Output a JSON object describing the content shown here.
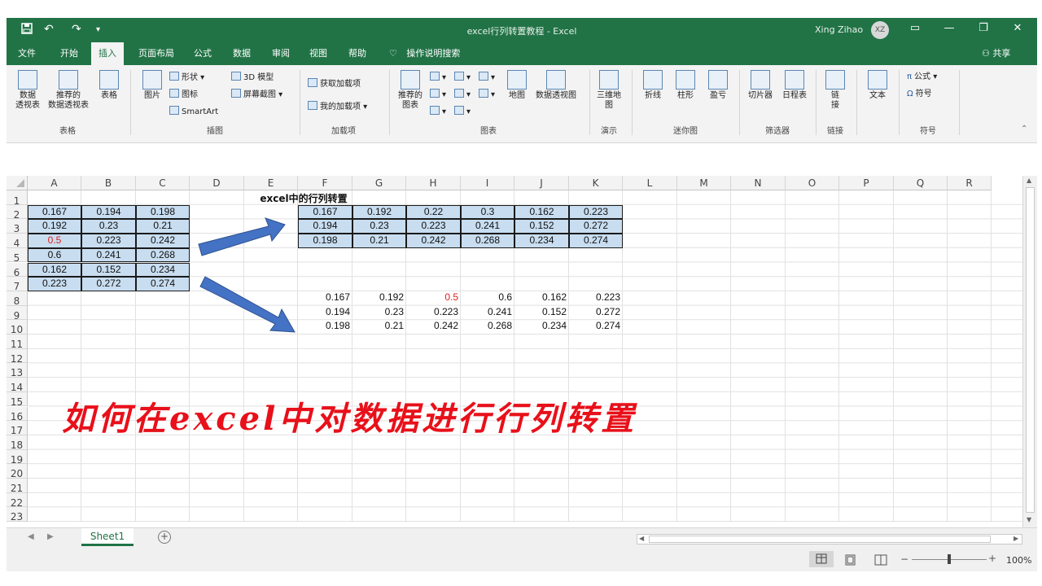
{
  "titlebar": {
    "title": "excel行列转置教程  -  Excel",
    "user": "Xing Zihao",
    "avatar": "XZ",
    "qat": [
      "save-icon",
      "undo-icon",
      "redo-icon",
      "customize-icon"
    ]
  },
  "tabs": [
    "文件",
    "开始",
    "插入",
    "页面布局",
    "公式",
    "数据",
    "审阅",
    "视图",
    "帮助"
  ],
  "active_tab": "插入",
  "tell_me": "操作说明搜索",
  "share": "共享",
  "ribbon": {
    "groups": {
      "tables": "表格",
      "illustrations": "插图",
      "addins": "加载项",
      "charts": "图表",
      "tours": "演示",
      "sparklines": "迷你图",
      "filters": "筛选器",
      "links": "链接",
      "symbols": "符号"
    },
    "buttons": {
      "pivot_line1": "数据",
      "pivot_line2": "透视表",
      "rec_pivot_line1": "推荐的",
      "rec_pivot_line2": "数据透视表",
      "table": "表格",
      "pictures": "图片",
      "shapes": "形状",
      "icons": "图标",
      "smartart": "SmartArt",
      "model3d": "3D 模型",
      "screenshot": "屏幕截图",
      "get_addins": "获取加载项",
      "my_addins": "我的加载项",
      "rec_charts_line1": "推荐的",
      "rec_charts_line2": "图表",
      "map": "地图",
      "pivot_chart": "数据透视图",
      "map3d_line1": "三维地",
      "map3d_line2": "图",
      "spark_line": "折线",
      "spark_column": "柱形",
      "spark_winloss": "盈亏",
      "slicer": "切片器",
      "timeline": "日程表",
      "link_line1": "链",
      "link_line2": "接",
      "text": "文本",
      "equation": "公式",
      "symbol": "符号"
    }
  },
  "grid": {
    "columns": [
      "A",
      "B",
      "C",
      "D",
      "E",
      "F",
      "G",
      "H",
      "I",
      "J",
      "K",
      "L",
      "M",
      "N",
      "O",
      "P",
      "Q",
      "R"
    ],
    "rows": [
      "1",
      "2",
      "3",
      "4",
      "5",
      "6",
      "7",
      "8",
      "9",
      "10",
      "11",
      "12",
      "13",
      "14",
      "15",
      "16",
      "17",
      "18",
      "19",
      "20",
      "21",
      "22",
      "23"
    ],
    "heading": "excel中的行列转置",
    "source": [
      [
        "0.167",
        "0.194",
        "0.198"
      ],
      [
        "0.192",
        "0.23",
        "0.21"
      ],
      [
        "0.5",
        "0.223",
        "0.242"
      ],
      [
        "0.6",
        "0.241",
        "0.268"
      ],
      [
        "0.162",
        "0.152",
        "0.234"
      ],
      [
        "0.223",
        "0.272",
        "0.274"
      ]
    ],
    "transposed_boxed": [
      [
        "0.167",
        "0.192",
        "0.22",
        "0.3",
        "0.162",
        "0.223"
      ],
      [
        "0.194",
        "0.23",
        "0.223",
        "0.241",
        "0.152",
        "0.272"
      ],
      [
        "0.198",
        "0.21",
        "0.242",
        "0.268",
        "0.234",
        "0.274"
      ]
    ],
    "transposed_plain": [
      [
        "0.167",
        "0.192",
        "0.5",
        "0.6",
        "0.162",
        "0.223"
      ],
      [
        "0.194",
        "0.23",
        "0.223",
        "0.241",
        "0.152",
        "0.272"
      ],
      [
        "0.198",
        "0.21",
        "0.242",
        "0.268",
        "0.234",
        "0.274"
      ]
    ],
    "highlight_color": "#e02020",
    "cell_fill": "#c8ddf0"
  },
  "overlay_title": "如何在excel中对数据进行行列转置",
  "overlay_color": "#e8101a",
  "sheet": {
    "name": "Sheet1"
  },
  "status": {
    "zoom": "100%"
  },
  "colors": {
    "excel_green": "#217346",
    "arrow_blue": "#4472c4"
  }
}
